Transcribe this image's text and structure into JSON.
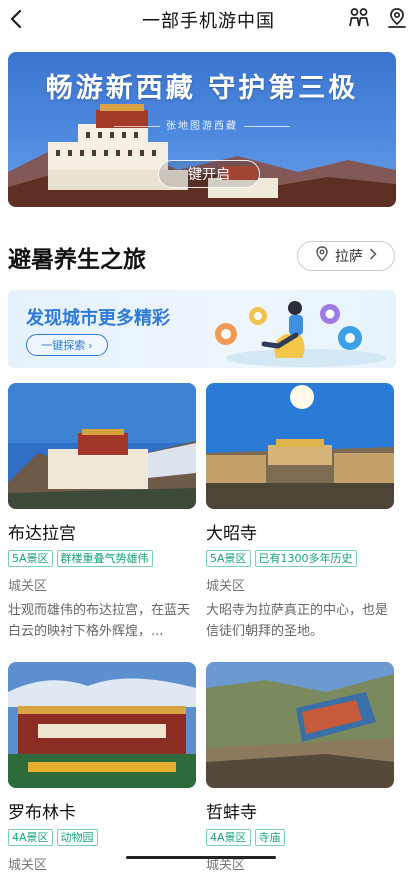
{
  "header": {
    "title": "一部手机游中国",
    "icons": [
      "back-arrow-icon",
      "people-icon",
      "location-pin-icon"
    ]
  },
  "banner": {
    "title": "畅游新西藏 守护第三极",
    "subtitle": "张地图游西藏",
    "cta": "键开启"
  },
  "section": {
    "title": "避暑养生之旅",
    "city": "拉萨"
  },
  "discover": {
    "title": "发现城市更多精彩",
    "button": "一键探索"
  },
  "cards": [
    {
      "name": "布达拉宫",
      "tags": [
        "5A景区",
        "群楼重叠气势雄伟"
      ],
      "district": "城关区",
      "desc": "壮观而雄伟的布达拉宫，在蓝天白云的映衬下格外辉煌，..."
    },
    {
      "name": "大昭寺",
      "tags": [
        "5A景区",
        "已有1300多年历史"
      ],
      "district": "城关区",
      "desc": "大昭寺为拉萨真正的中心，也是信徒们朝拜的圣地。"
    },
    {
      "name": "罗布林卡",
      "tags": [
        "4A景区",
        "动物园"
      ],
      "district": "城关区",
      "desc": ""
    },
    {
      "name": "哲蚌寺",
      "tags": [
        "4A景区",
        "寺庙"
      ],
      "district": "城关区",
      "desc": ""
    }
  ],
  "colors": {
    "accent": "#2e7bd6",
    "tag": "#1aa37a",
    "banner": "#3a74cf"
  }
}
